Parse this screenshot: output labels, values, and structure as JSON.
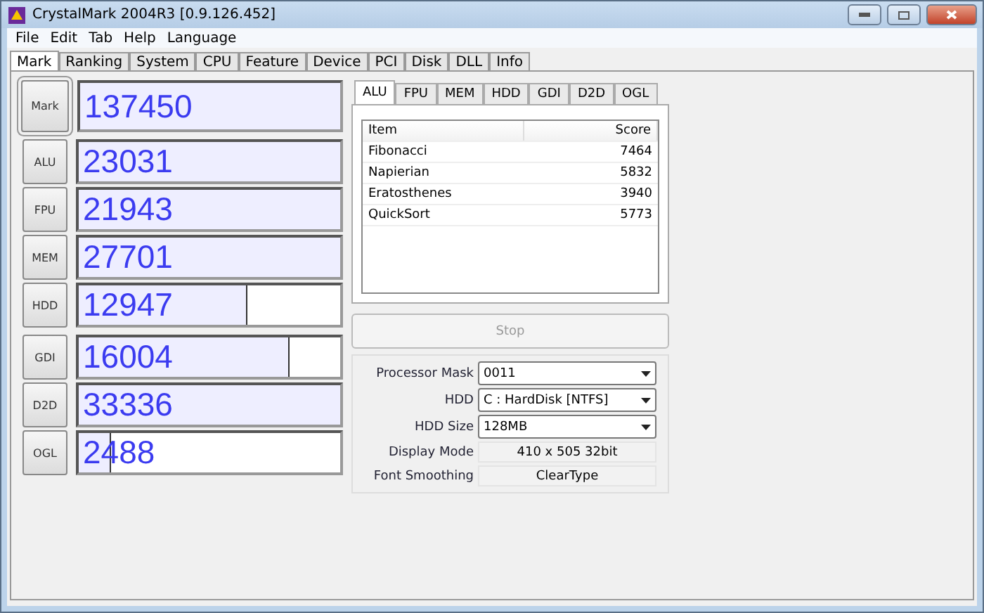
{
  "window": {
    "title": "CrystalMark 2004R3 [0.9.126.452]"
  },
  "menu": [
    "File",
    "Edit",
    "Tab",
    "Help",
    "Language"
  ],
  "tabs": [
    {
      "label": "Mark",
      "selected": true
    },
    {
      "label": "Ranking",
      "selected": false
    },
    {
      "label": "System",
      "selected": false
    },
    {
      "label": "CPU",
      "selected": false
    },
    {
      "label": "Feature",
      "selected": false
    },
    {
      "label": "Device",
      "selected": false
    },
    {
      "label": "PCI",
      "selected": false
    },
    {
      "label": "Disk",
      "selected": false
    },
    {
      "label": "DLL",
      "selected": false
    },
    {
      "label": "Info",
      "selected": false
    }
  ],
  "score_groups": [
    [
      {
        "label": "Mark",
        "value": "137450",
        "level": 1,
        "selected": true
      }
    ],
    [
      {
        "label": "ALU",
        "value": "23031",
        "level": 1,
        "selected": false
      },
      {
        "label": "FPU",
        "value": "21943",
        "level": 1,
        "selected": false
      },
      {
        "label": "MEM",
        "value": "27701",
        "level": 1,
        "selected": false
      },
      {
        "label": "HDD",
        "value": "12947",
        "level": 0.64,
        "selected": false
      }
    ],
    [
      {
        "label": "GDI",
        "value": "16004",
        "level": 0.8,
        "selected": false
      },
      {
        "label": "D2D",
        "value": "33336",
        "level": 1,
        "selected": false
      },
      {
        "label": "OGL",
        "value": "2488",
        "level": 0.12,
        "selected": false
      }
    ]
  ],
  "sub_tabs": [
    {
      "label": "ALU",
      "selected": true
    },
    {
      "label": "FPU",
      "selected": false
    },
    {
      "label": "MEM",
      "selected": false
    },
    {
      "label": "HDD",
      "selected": false
    },
    {
      "label": "GDI",
      "selected": false
    },
    {
      "label": "D2D",
      "selected": false
    },
    {
      "label": "OGL",
      "selected": false
    }
  ],
  "table": {
    "columns": [
      "Item",
      "Score"
    ],
    "rows": [
      [
        "Fibonacci",
        "7464"
      ],
      [
        "Napierian",
        "5832"
      ],
      [
        "Eratosthenes",
        "3940"
      ],
      [
        "QuickSort",
        "5773"
      ]
    ]
  },
  "stop_button": {
    "label": "Stop",
    "disabled": true
  },
  "settings": [
    {
      "label": "Processor Mask",
      "value": "0011",
      "kind": "dropdown"
    },
    {
      "label": "HDD",
      "value": "C : HardDisk [NTFS]",
      "kind": "dropdown"
    },
    {
      "label": "HDD Size",
      "value": "128MB",
      "kind": "dropdown"
    },
    {
      "label": "Display Mode",
      "value": "410 x 505 32bit",
      "kind": "readonly"
    },
    {
      "label": "Font Smoothing",
      "value": "ClearType",
      "kind": "readonly"
    }
  ]
}
